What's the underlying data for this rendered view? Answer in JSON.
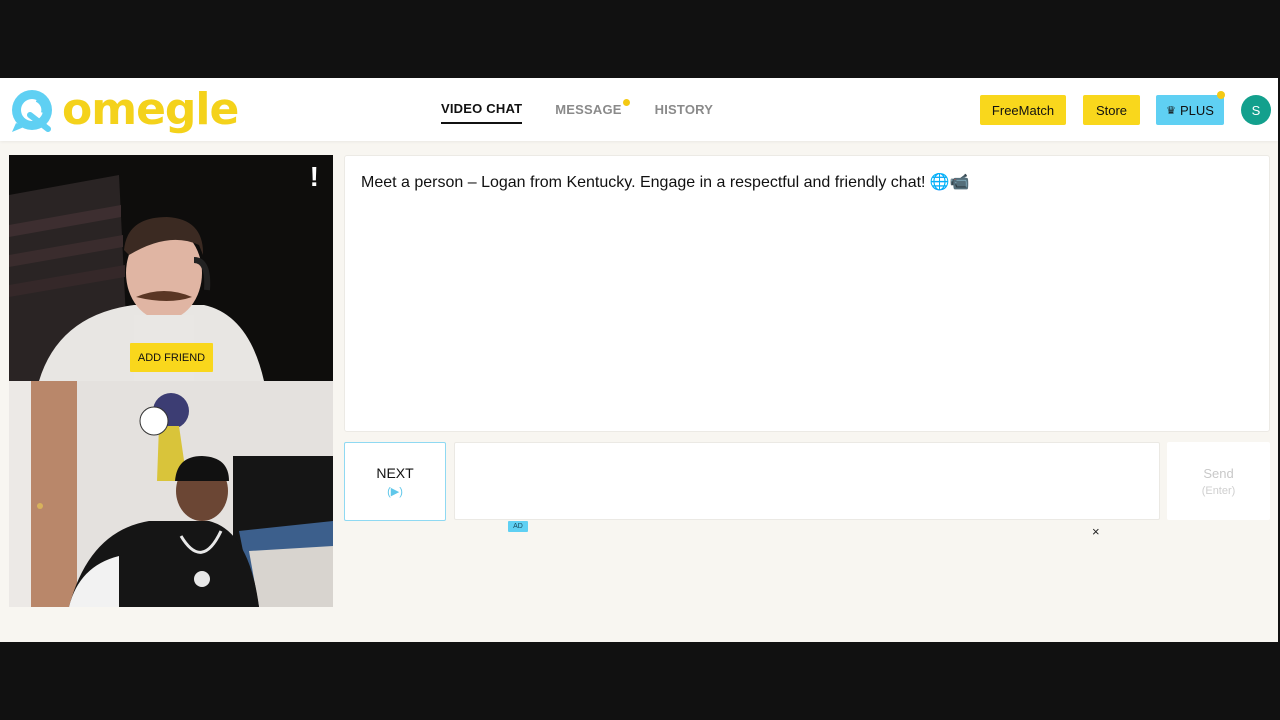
{
  "brand": {
    "name": "omegle"
  },
  "nav": {
    "video_chat": "VIDEO CHAT",
    "message": "MESSAGE",
    "history": "HISTORY"
  },
  "header_buttons": {
    "freematch": "FreeMatch",
    "store": "Store",
    "plus": "PLUS",
    "avatar_initial": "S"
  },
  "remote_video": {
    "report_symbol": "!",
    "add_friend": "ADD FRIEND"
  },
  "chat": {
    "message": "Meet a person – Logan from Kentucky. Engage in a respectful and friendly chat! 🌐📹"
  },
  "controls": {
    "next_label": "NEXT",
    "next_hint": "(▶)",
    "send_label": "Send",
    "send_hint": "(Enter)",
    "input_value": ""
  },
  "ad": {
    "badge": "AD",
    "close": "×"
  },
  "colors": {
    "brand_yellow": "#f4d21b",
    "brand_blue": "#5fd0f3",
    "avatar_teal": "#13a08d",
    "background": "#f8f6f1"
  }
}
